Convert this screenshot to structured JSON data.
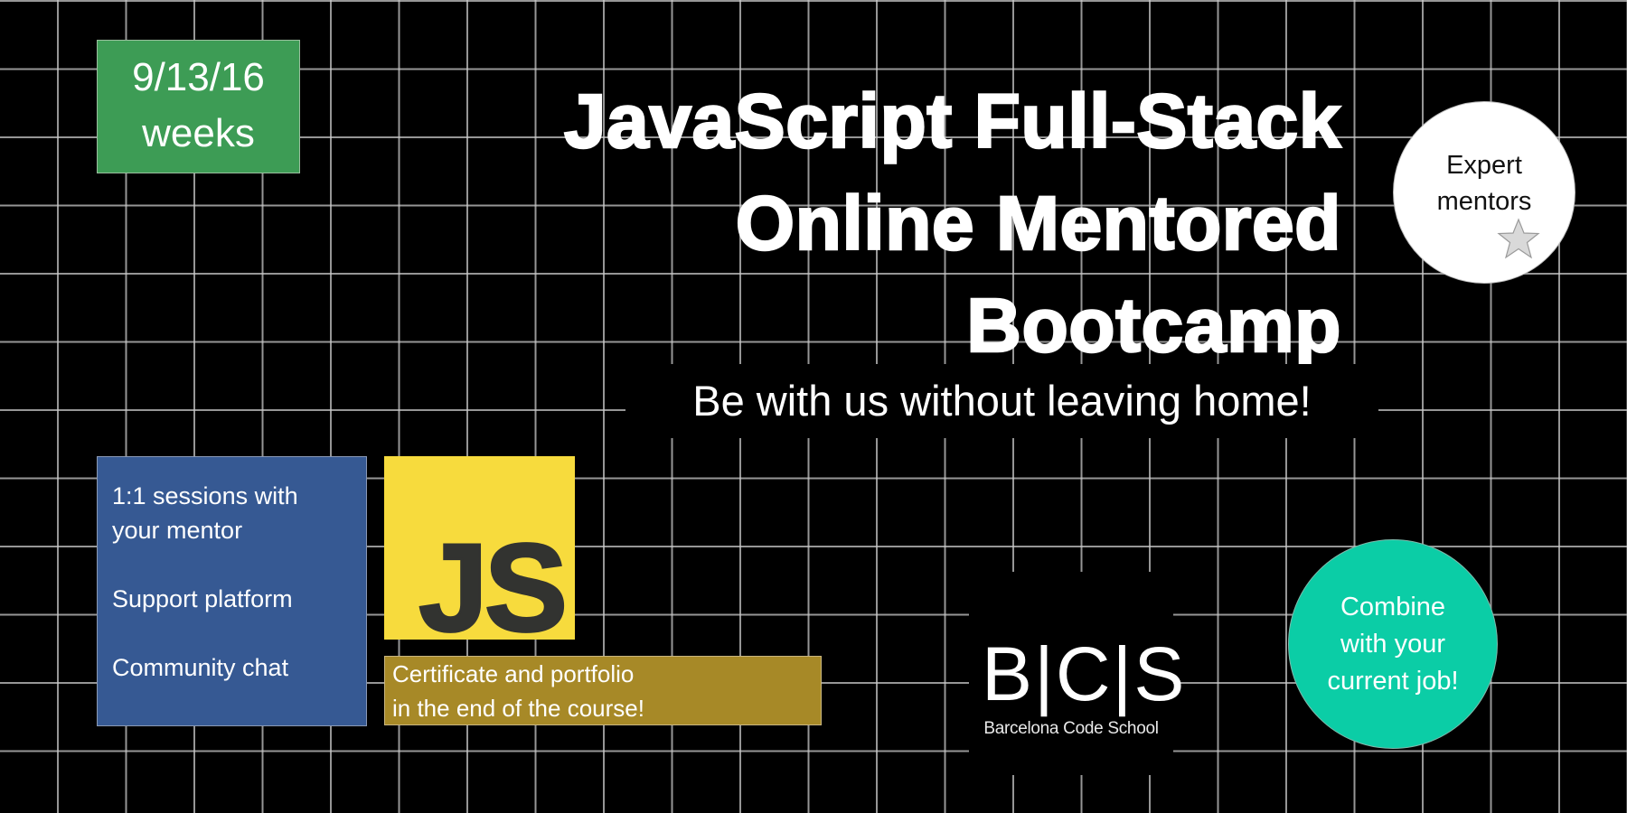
{
  "badge": {
    "date": "9/13/16",
    "duration": "weeks"
  },
  "title": {
    "lines": [
      "JavaScript Full-Stack",
      "Online Mentored",
      "Bootcamp"
    ]
  },
  "subtitle": "Be with us without leaving home!",
  "expert_badge": {
    "lines": [
      "Expert",
      "mentors"
    ],
    "icon": "star-icon"
  },
  "features": {
    "items": [
      {
        "lines": [
          "1:1 sessions with",
          "your mentor"
        ]
      },
      {
        "lines": [
          "Support platform"
        ]
      },
      {
        "lines": [
          "Community chat"
        ]
      }
    ]
  },
  "js_logo": {
    "text": "JS"
  },
  "certificate": {
    "lines": [
      "Certificate and portfolio",
      "in the end of the course!"
    ]
  },
  "school_logo": {
    "mark": "B|C|S",
    "name": "Barcelona Code School"
  },
  "combine_badge": {
    "lines": [
      "Combine",
      "with your",
      "current job!"
    ]
  },
  "colors": {
    "background": "#000000",
    "grid": "#c8c8c8",
    "badge_green": "#3d9c55",
    "features_blue": "#365993",
    "js_yellow": "#f7db3d",
    "js_text": "#323330",
    "certificate_gold": "#a78927",
    "combine_teal": "#0bcda6",
    "star_fill": "#d9d9d9"
  }
}
